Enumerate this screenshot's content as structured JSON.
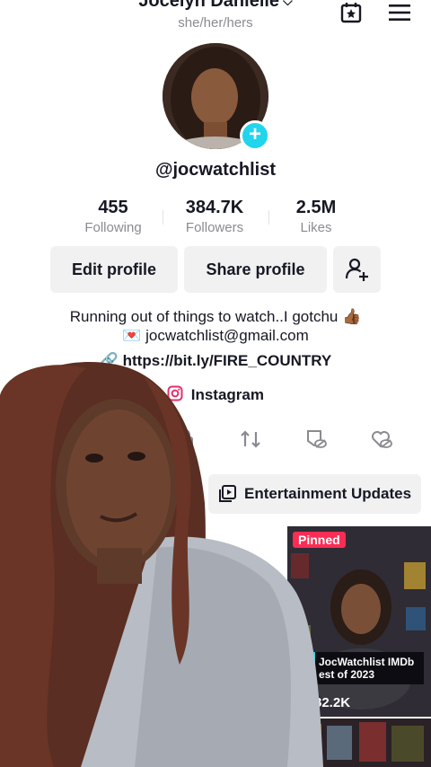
{
  "header": {
    "profile_name": "Jocelyn Danielle",
    "pronouns": "she/her/hers"
  },
  "profile": {
    "username": "@jocwatchlist",
    "stats": [
      {
        "value": "455",
        "label": "Following"
      },
      {
        "value": "384.7K",
        "label": "Followers"
      },
      {
        "value": "2.5M",
        "label": "Likes"
      }
    ],
    "buttons": {
      "edit": "Edit profile",
      "share": "Share profile"
    },
    "bio_line1": "Running out of things to watch..I gotchu 👍🏾",
    "bio_line2": "💌 jocwatchlist@gmail.com",
    "link": "https://bit.ly/FIRE_COUNTRY",
    "instagram": "Instagram"
  },
  "playlist": {
    "label": "Entertainment Updates"
  },
  "videos": [
    {
      "badge": "Pinned",
      "title": "JocWatchlist IMDb\nest of 2023",
      "views": "82.2K"
    }
  ],
  "colors": {
    "accent": "#20d5ec",
    "pinned": "#fe2c55",
    "text": "#161823",
    "muted": "#8a8b91",
    "button_bg": "#f1f1f2"
  }
}
